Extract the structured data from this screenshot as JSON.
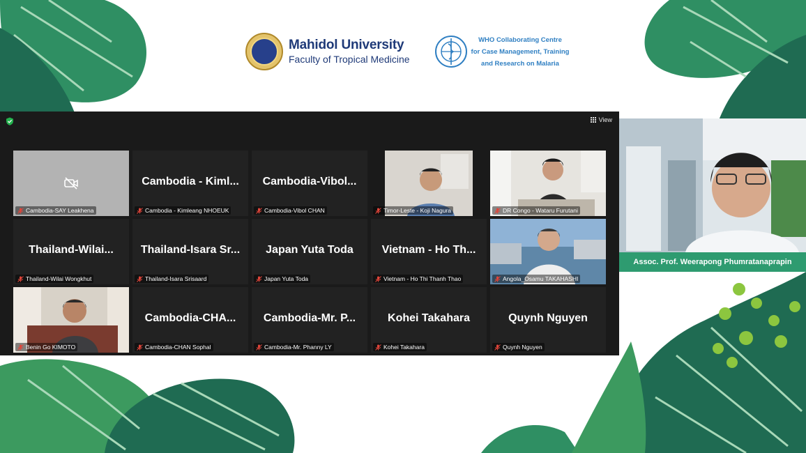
{
  "header": {
    "university": "Mahidol University",
    "faculty": "Faculty of Tropical Medicine",
    "who_line1": "WHO Collaborating Centre",
    "who_line2": "for Case Management, Training",
    "who_line3": "and Research on Malaria"
  },
  "zoom": {
    "view_label": "View",
    "tiles": [
      {
        "big": "",
        "name": "Cambodia-SAY Leakhena"
      },
      {
        "big": "Cambodia - Kiml...",
        "name": "Cambodia - Kimleang NHOEUK"
      },
      {
        "big": "Cambodia-Vibol...",
        "name": "Cambodia-Vibol CHAN"
      },
      {
        "big": "",
        "name": "Timor-Leste - Koji Nagura"
      },
      {
        "big": "",
        "name": "DR Congo - Wataru Furutani"
      },
      {
        "big": "Thailand-Wilai...",
        "name": "Thailand-Wilai Wongkhut"
      },
      {
        "big": "Thailand-Isara Sr...",
        "name": "Thailand-Isara Srisaard"
      },
      {
        "big": "Japan Yuta Toda",
        "name": "Japan Yuta Toda"
      },
      {
        "big": "Vietnam - Ho Th...",
        "name": "Vietnam - Ho Thi Thanh Thao"
      },
      {
        "big": "",
        "name": "Angola_Osamu TAKAHASHI"
      },
      {
        "big": "",
        "name": "Benin Go KIMOTO"
      },
      {
        "big": "Cambodia-CHA...",
        "name": "Cambodia-CHAN Sophal"
      },
      {
        "big": "Cambodia-Mr. P...",
        "name": "Cambodia-Mr. Phanny LY"
      },
      {
        "big": "Kohei Takahara",
        "name": "Kohei Takahara"
      },
      {
        "big": "Quynh Nguyen",
        "name": "Quynh Nguyen"
      }
    ]
  },
  "speaker": {
    "caption": "Assoc. Prof. Weerapong Phumratanaprapin"
  },
  "colors": {
    "caption_bg": "#2e9b70",
    "leaf_dark": "#1f6b52",
    "leaf_mid": "#2f8f63",
    "muted_mic": "#e0453a"
  }
}
